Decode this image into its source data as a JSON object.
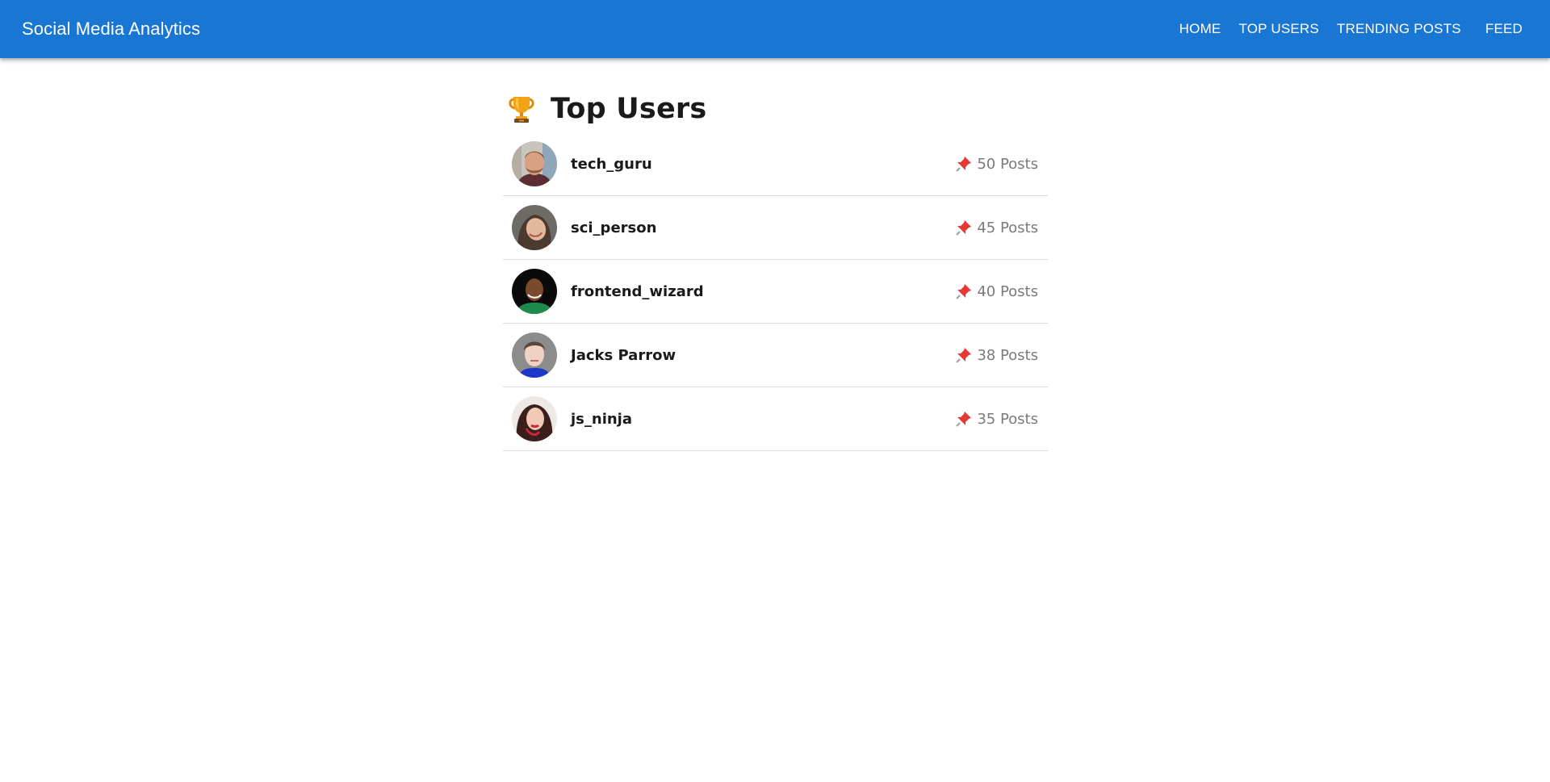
{
  "appbar": {
    "title": "Social Media Analytics",
    "nav": [
      "HOME",
      "TOP USERS",
      "TRENDING POSTS",
      "FEED"
    ]
  },
  "main": {
    "heading": "Top Users",
    "heading_icon": "trophy-icon",
    "post_icon": "pushpin-icon",
    "users": [
      {
        "name": "tech_guru",
        "posts": "50 Posts"
      },
      {
        "name": "sci_person",
        "posts": "45 Posts"
      },
      {
        "name": "frontend_wizard",
        "posts": "40 Posts"
      },
      {
        "name": "Jacks Parrow",
        "posts": "38 Posts"
      },
      {
        "name": "js_ninja",
        "posts": "35 Posts"
      }
    ]
  },
  "colors": {
    "appbar": "#1976d2",
    "pin": "#e53935",
    "trophy": "#f2a314",
    "divider": "#dcdcdc"
  }
}
